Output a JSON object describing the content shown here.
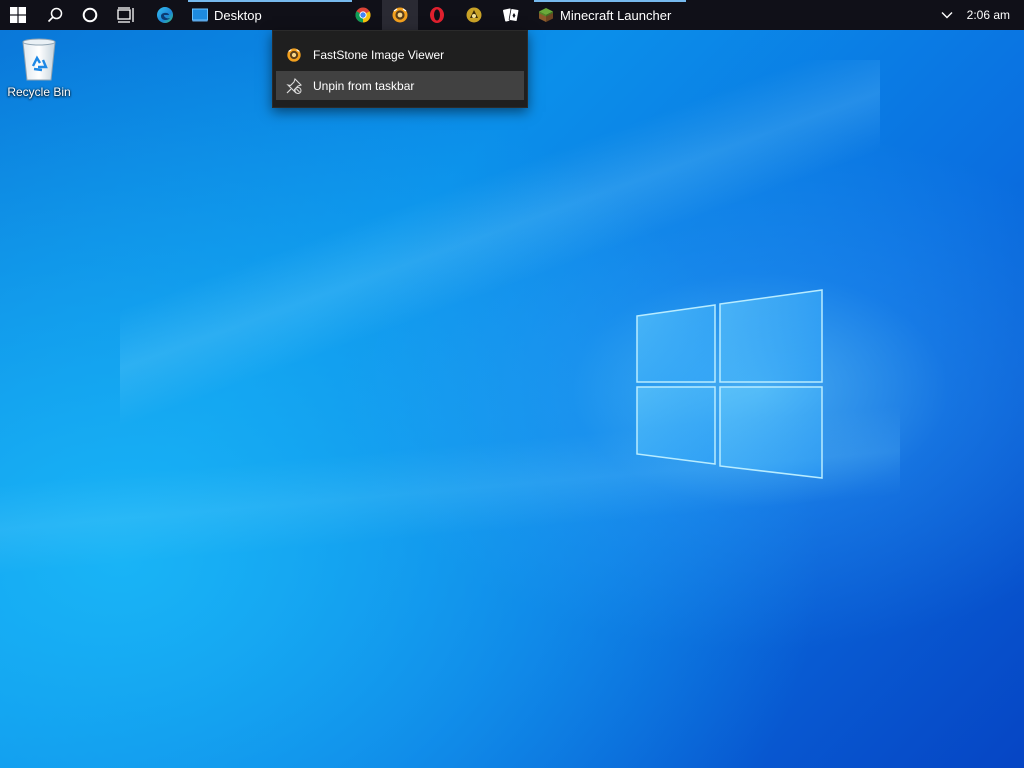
{
  "desktop": {
    "icons": [
      {
        "label": "Recycle Bin",
        "icon": "recycle-bin-icon"
      }
    ]
  },
  "taskbar": {
    "start": {
      "icon": "windows-start-icon"
    },
    "search": {
      "icon": "search-icon"
    },
    "cortana": {
      "icon": "cortana-circle-icon"
    },
    "task_view": {
      "icon": "task-view-icon"
    },
    "apps": [
      {
        "name": "edge",
        "icon": "edge-icon"
      },
      {
        "name": "desktop",
        "label": "Desktop",
        "icon": "desktop-window-icon",
        "active": true
      },
      {
        "name": "chrome",
        "icon": "chrome-icon"
      },
      {
        "name": "faststone",
        "icon": "faststone-icon",
        "highlighted": true
      },
      {
        "name": "opera",
        "icon": "opera-icon"
      },
      {
        "name": "app-gold",
        "icon": "gold-app-icon"
      },
      {
        "name": "solitaire",
        "icon": "cards-icon"
      },
      {
        "name": "minecraft",
        "label": "Minecraft Launcher",
        "icon": "minecraft-grass-block-icon",
        "active": true
      }
    ],
    "tray": {
      "chevron_icon": "chevron-up-icon"
    },
    "clock": "2:06 am"
  },
  "jump_list": {
    "items": [
      {
        "label": "FastStone Image Viewer",
        "icon": "faststone-icon"
      },
      {
        "label": "Unpin from taskbar",
        "icon": "unpin-icon",
        "hovered": true
      }
    ]
  },
  "colors": {
    "taskbar_bg": "#101018",
    "active_indicator": "#76b9ed",
    "menu_bg": "#1f1f1f",
    "menu_hover": "#414141",
    "desktop_blue": "#0b8fea"
  }
}
